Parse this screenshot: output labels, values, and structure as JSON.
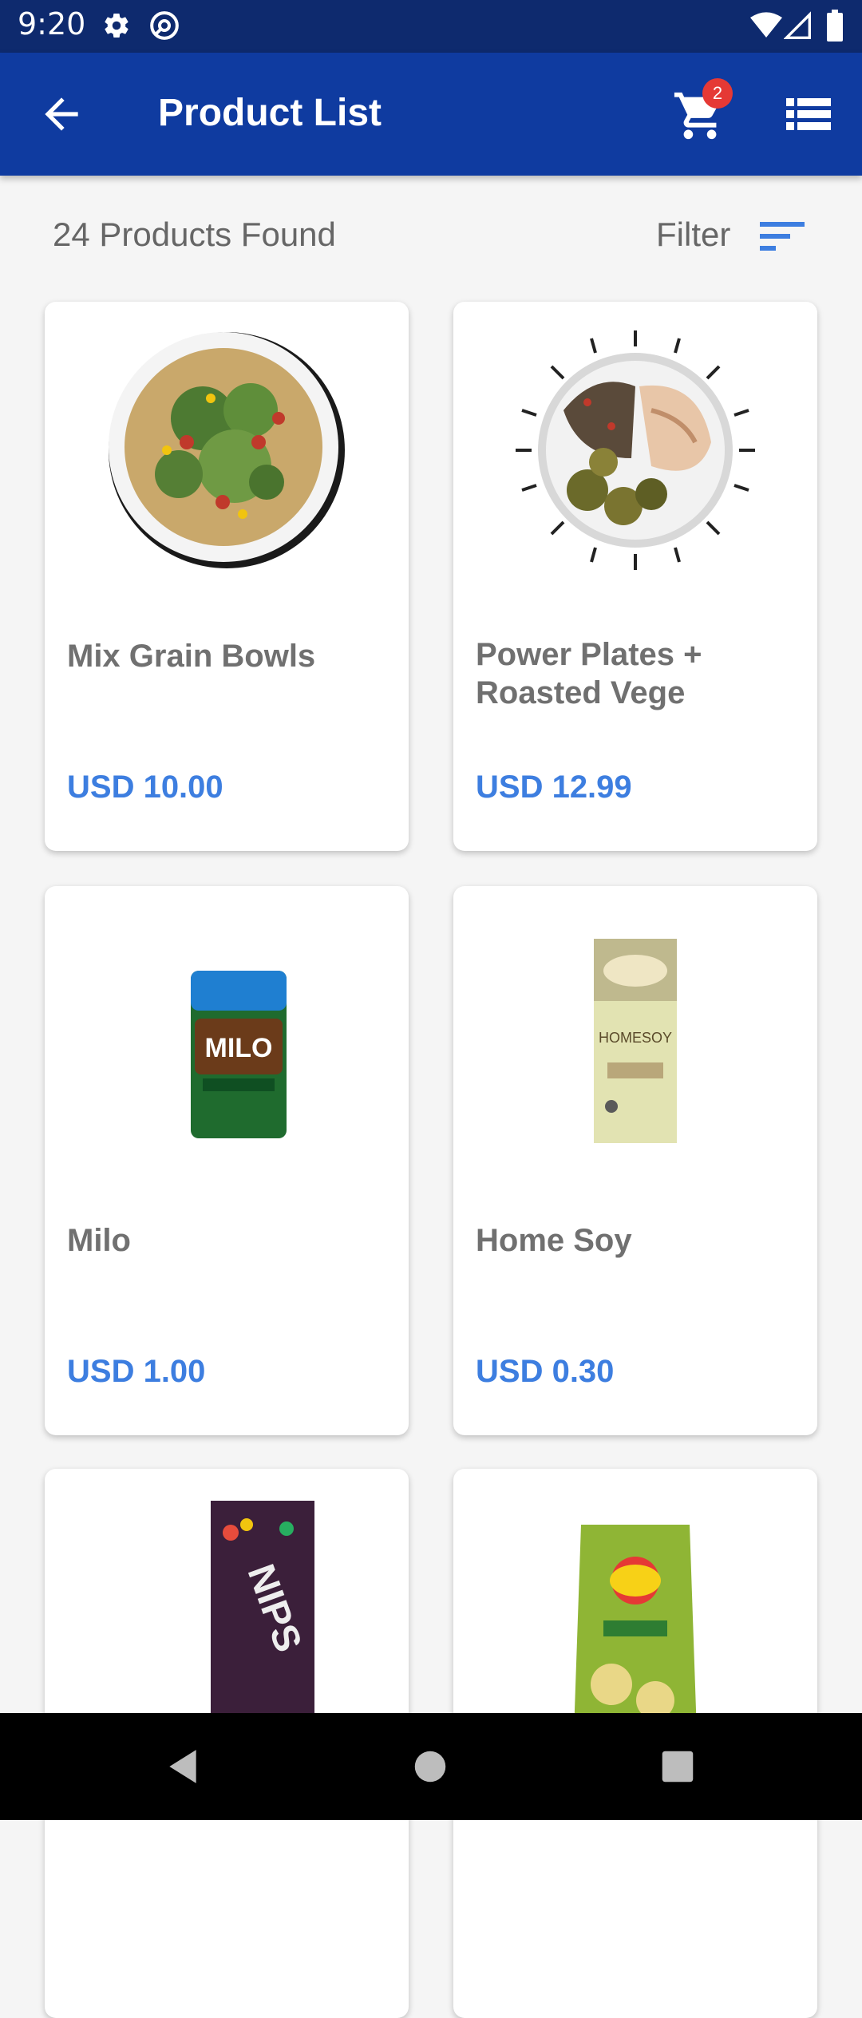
{
  "status_bar": {
    "time": "9:20",
    "icons": [
      "gear-icon",
      "at-sign-icon",
      "wifi-icon",
      "signal-icon",
      "battery-icon"
    ]
  },
  "app_bar": {
    "title": "Product List",
    "back_icon": "arrow-left-icon",
    "cart_icon": "shopping-cart-icon",
    "cart_badge": "2",
    "menu_icon": "list-view-icon",
    "color": "#0f3ba0"
  },
  "results": {
    "count_text": "24 Products Found",
    "filter_label": "Filter",
    "filter_icon": "sort-lines-icon"
  },
  "products": [
    {
      "name": "Mix Grain Bowls",
      "price": "USD 10.00",
      "image": "salad-bowl-image"
    },
    {
      "name": "Power Plates + Roasted Vege",
      "price": "USD 12.99",
      "image": "chicken-plate-image"
    },
    {
      "name": "Milo",
      "price": "USD 1.00",
      "image": "milo-can-image"
    },
    {
      "name": "Home Soy",
      "price": "USD 0.30",
      "image": "soy-milk-carton-image"
    },
    {
      "name": "",
      "price": "",
      "image": "nips-chocolate-image"
    },
    {
      "name": "",
      "price": "",
      "image": "lays-chips-bag-image"
    }
  ],
  "nav_bar": {
    "icons": [
      "back-triangle-icon",
      "home-circle-icon",
      "recents-square-icon"
    ]
  },
  "colors": {
    "price": "#3d7ee0",
    "badge": "#e53935",
    "status_bar": "#0e2a6e"
  }
}
